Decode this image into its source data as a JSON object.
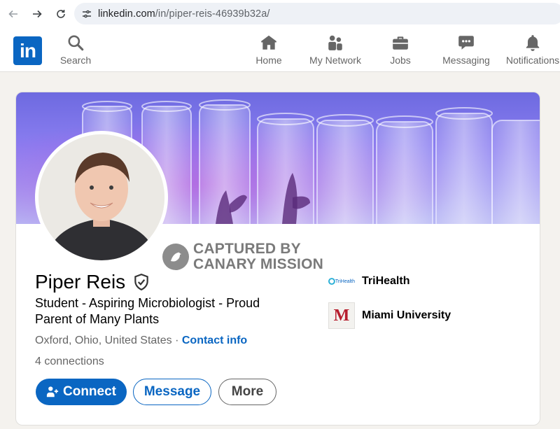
{
  "browser": {
    "url_host": "linkedin.com",
    "url_path": "/in/piper-reis-46939b32a/"
  },
  "header": {
    "logo_text": "in",
    "nav": [
      {
        "label": "Search",
        "icon": "search-icon"
      },
      {
        "label": "Home",
        "icon": "home-icon"
      },
      {
        "label": "My Network",
        "icon": "network-icon"
      },
      {
        "label": "Jobs",
        "icon": "briefcase-icon"
      },
      {
        "label": "Messaging",
        "icon": "message-icon"
      },
      {
        "label": "Notifications",
        "icon": "bell-icon"
      }
    ]
  },
  "watermark": {
    "line1": "CAPTURED BY",
    "line2": "CANARY MISSION"
  },
  "profile": {
    "name": "Piper Reis",
    "headline": "Student - Aspiring Microbiologist - Proud Parent of Many Plants",
    "location": "Oxford, Ohio, United States",
    "separator": " · ",
    "contact_info": "Contact info",
    "connections": "4 connections",
    "organizations": [
      {
        "name": "TriHealth",
        "logo_text": "TriHealth"
      },
      {
        "name": "Miami University",
        "logo_text": "M"
      }
    ]
  },
  "actions": {
    "connect": "Connect",
    "message": "Message",
    "more": "More"
  },
  "colors": {
    "brand": "#0a66c2",
    "miami_red": "#b61e2e"
  }
}
